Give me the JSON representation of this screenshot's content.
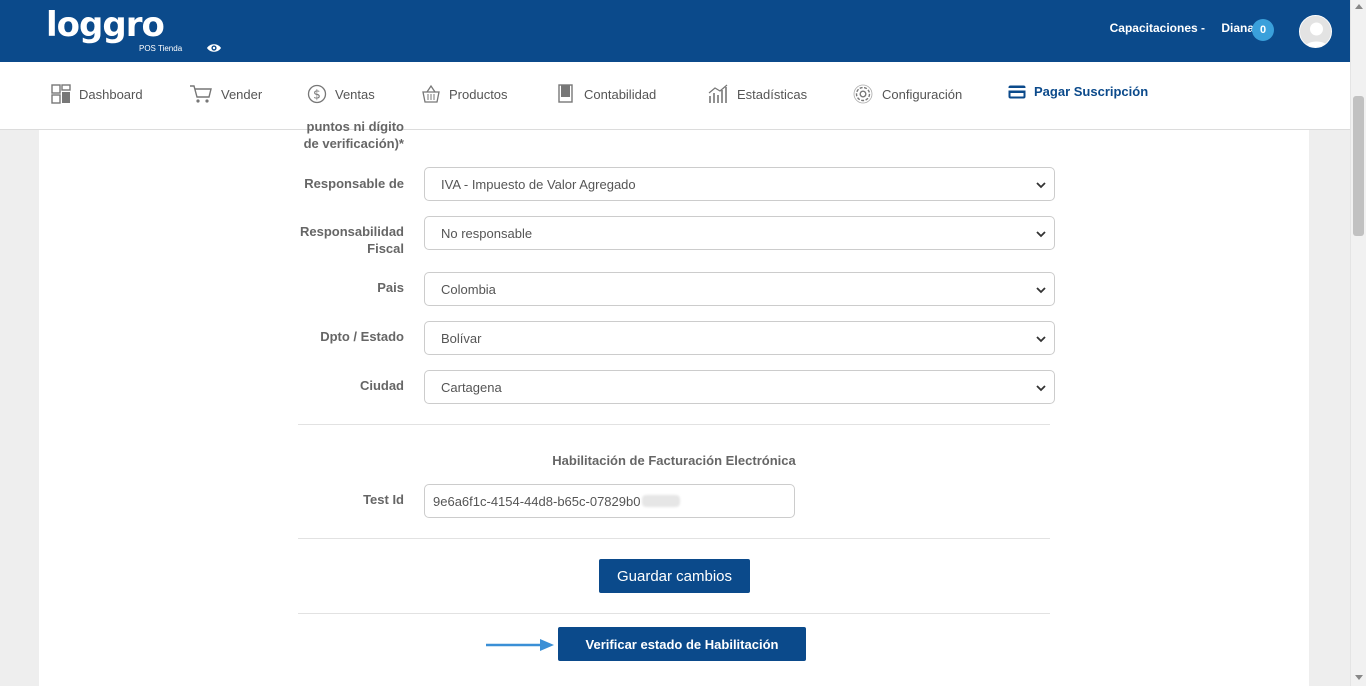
{
  "header": {
    "logo_text": "loggro",
    "logo_sub": "POS Tienda",
    "company": "Capacitaciones -",
    "user": "Diana",
    "notifications": "0"
  },
  "nav": {
    "items": [
      {
        "label": "Dashboard",
        "icon": "dashboard-icon"
      },
      {
        "label": "Vender",
        "icon": "cart-icon"
      },
      {
        "label": "Ventas",
        "icon": "dollar-icon"
      },
      {
        "label": "Productos",
        "icon": "basket-icon"
      },
      {
        "label": "Contabilidad",
        "icon": "book-icon"
      },
      {
        "label": "Estadísticas",
        "icon": "chart-icon"
      },
      {
        "label": "Configuración",
        "icon": "gear-icon"
      },
      {
        "label": "Pagar Suscripción",
        "icon": "credit-card-icon"
      }
    ]
  },
  "form": {
    "partial_label_line1": "puntos ni dígito",
    "partial_label_line2": "de verificación)*",
    "responsable_label": "Responsable de",
    "responsable_value": "IVA - Impuesto de Valor Agregado",
    "responsabilidad_label_line1": "Responsabilidad",
    "responsabilidad_label_line2": "Fiscal",
    "responsabilidad_value": "No responsable",
    "pais_label": "Pais",
    "pais_value": "Colombia",
    "dpto_label": "Dpto / Estado",
    "dpto_value": "Bolívar",
    "ciudad_label": "Ciudad",
    "ciudad_value": "Cartagena",
    "section_title": "Habilitación de Facturación Electrónica",
    "test_id_label": "Test Id",
    "test_id_value": "9e6a6f1c-4154-44d8-b65c-07829b0"
  },
  "buttons": {
    "save": "Guardar cambios",
    "verify": "Verificar estado de Habilitación"
  },
  "colors": {
    "primary": "#0b4a8b",
    "badge": "#3aa0db",
    "arrow": "#3a8fd6"
  }
}
